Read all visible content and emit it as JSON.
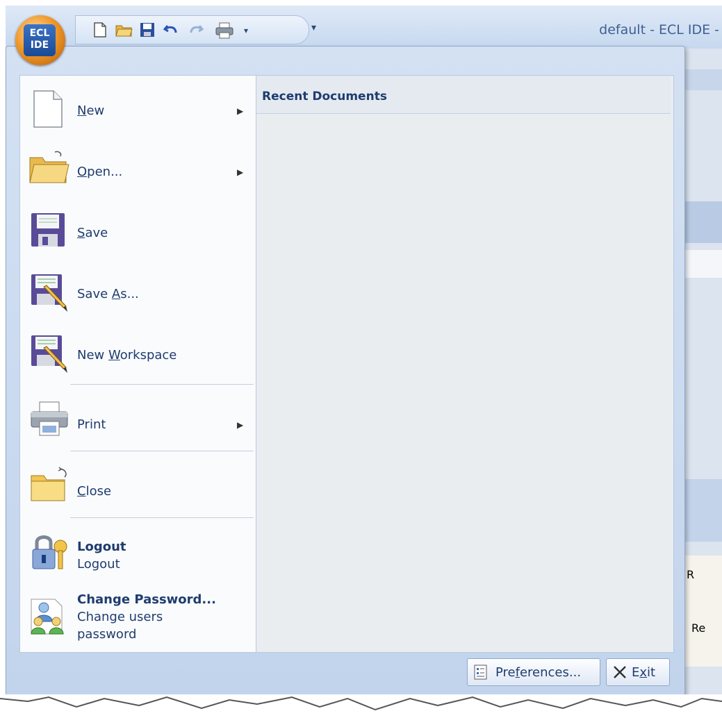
{
  "window": {
    "title": "default - ECL IDE -"
  },
  "app_button": {
    "line1": "ECL",
    "line2": "IDE"
  },
  "quick_access": {
    "items": [
      "new-document-icon",
      "open-folder-icon",
      "save-disk-icon",
      "undo-icon",
      "redo-icon",
      "print-icon"
    ],
    "dropdown_glyph": "▾",
    "customize_glyph": "₹"
  },
  "menu": {
    "items": {
      "new": {
        "label": "New",
        "mnemonic": "N"
      },
      "open": {
        "label": "Open...",
        "mnemonic": "O"
      },
      "save": {
        "label": "Save",
        "mnemonic": "S"
      },
      "save_as": {
        "label_prefix": "Save ",
        "mnemonic": "A",
        "label_suffix": "s..."
      },
      "new_workspace": {
        "label_prefix": "New ",
        "mnemonic": "W",
        "label_suffix": "orkspace"
      },
      "print": {
        "label": "Print"
      },
      "close": {
        "label": "Close",
        "mnemonic": "C"
      },
      "logout": {
        "title": "Logout",
        "description": "Logout"
      },
      "change_password": {
        "title_prefix": "Change ",
        "mnemonic": "P",
        "title_suffix": "assword...",
        "description_line1": "Change users",
        "description_line2": "password"
      }
    },
    "submenu_arrow": "▶"
  },
  "recent_documents": {
    "title": "Recent Documents",
    "items": []
  },
  "footer": {
    "preferences": {
      "prefix": "Pre",
      "mnemonic": "f",
      "suffix": "erences..."
    },
    "exit": {
      "prefix": "E",
      "mnemonic": "x",
      "suffix": "it"
    }
  },
  "background_fragments": {
    "r1": "R",
    "r2": "Re"
  },
  "colors": {
    "accent": "#1f3c6e",
    "menu_frame": "#c6d8ef",
    "recent_bg": "#e9edf0"
  }
}
